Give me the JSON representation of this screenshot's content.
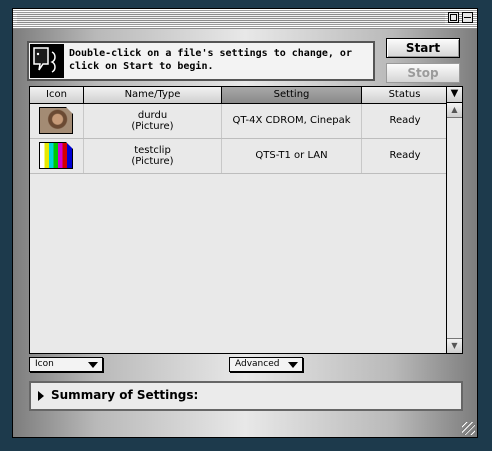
{
  "message": {
    "text": "Double-click on a file's settings to change, or click on Start to begin."
  },
  "buttons": {
    "start": "Start",
    "stop": "Stop"
  },
  "table": {
    "columns": [
      "Icon",
      "Name/Type",
      "Setting",
      "Status"
    ],
    "sorted_column": "Setting",
    "rows": [
      {
        "name": "durdu",
        "type": "(Picture)",
        "setting": "QT-4X CDROM, Cinepak",
        "status": "Ready",
        "icon": "photo-thumbnail-icon"
      },
      {
        "name": "testclip",
        "type": "(Picture)",
        "setting": "QTS-T1 or LAN",
        "status": "Ready",
        "icon": "color-bars-thumbnail-icon"
      }
    ]
  },
  "popups": {
    "view": "Icon",
    "advanced": "Advanced"
  },
  "summary": {
    "label": "Summary of Settings:"
  },
  "icons": {
    "help": "help-balloon-icon",
    "sort": "sort-order-icon"
  }
}
